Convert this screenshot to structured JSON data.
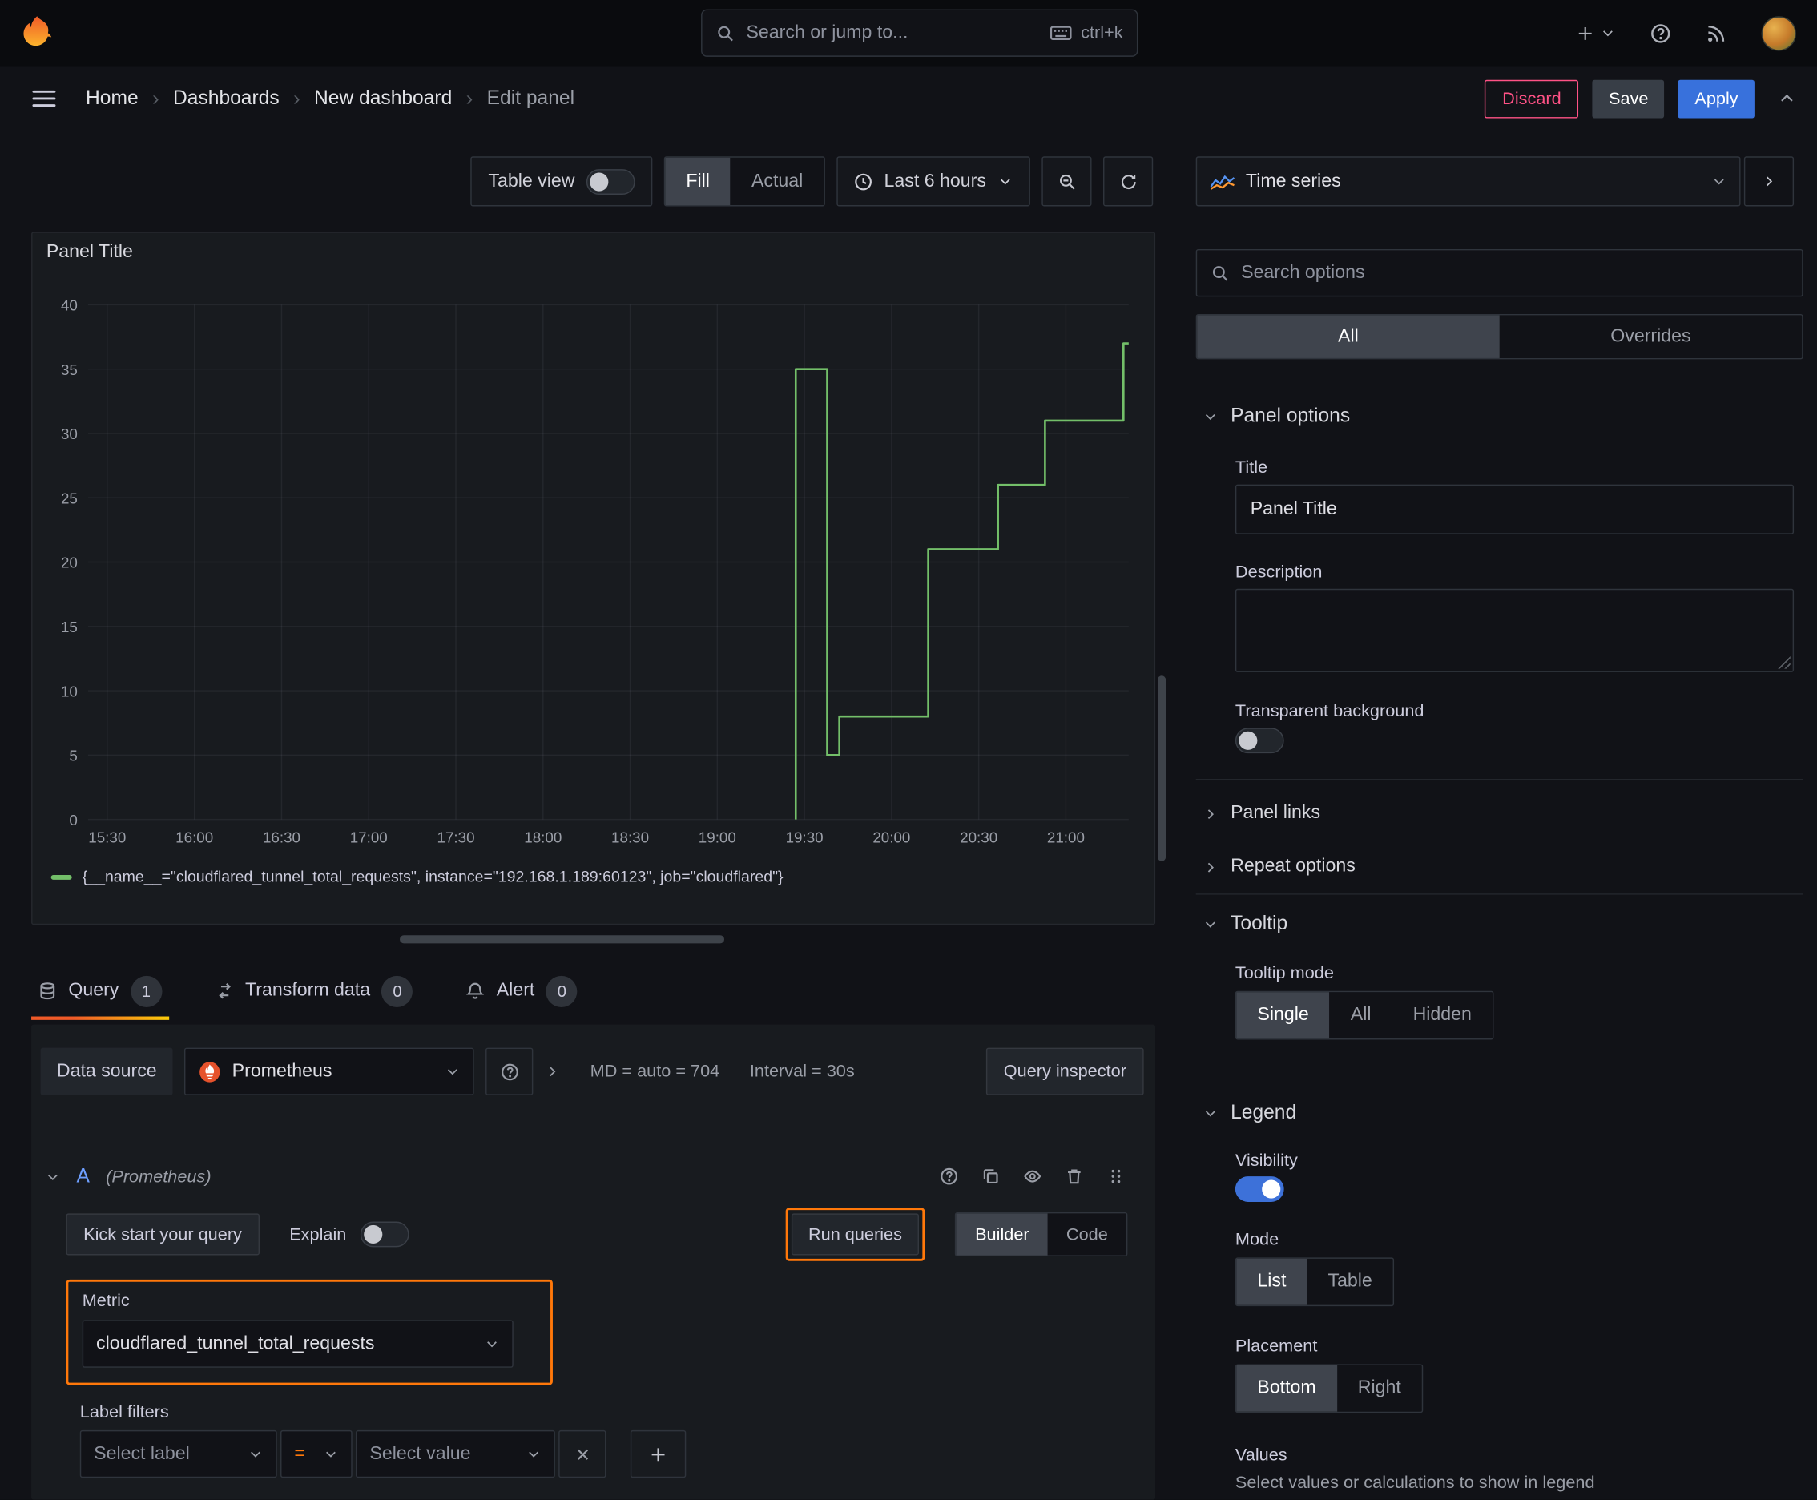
{
  "topbar": {
    "search_placeholder": "Search or jump to...",
    "shortcut": "ctrl+k"
  },
  "breadcrumb": {
    "items": [
      "Home",
      "Dashboards",
      "New dashboard",
      "Edit panel"
    ]
  },
  "actions": {
    "discard": "Discard",
    "save": "Save",
    "apply": "Apply"
  },
  "toolbar": {
    "table_view": "Table view",
    "fill": "Fill",
    "actual": "Actual",
    "time_range": "Last 6 hours"
  },
  "panel": {
    "title": "Panel Title"
  },
  "chart_data": {
    "type": "line",
    "title": "Panel Title",
    "x_unit": "time_of_day_hours",
    "xlim": [
      15.39,
      21.36
    ],
    "ylim": [
      0,
      40
    ],
    "y_ticks": [
      0,
      5,
      10,
      15,
      20,
      25,
      30,
      35,
      40
    ],
    "x_ticks": [
      {
        "v": 15.5,
        "label": "15:30"
      },
      {
        "v": 16.0,
        "label": "16:00"
      },
      {
        "v": 16.5,
        "label": "16:30"
      },
      {
        "v": 17.0,
        "label": "17:00"
      },
      {
        "v": 17.5,
        "label": "17:30"
      },
      {
        "v": 18.0,
        "label": "18:00"
      },
      {
        "v": 18.5,
        "label": "18:30"
      },
      {
        "v": 19.0,
        "label": "19:00"
      },
      {
        "v": 19.5,
        "label": "19:30"
      },
      {
        "v": 20.0,
        "label": "20:00"
      },
      {
        "v": 20.5,
        "label": "20:30"
      },
      {
        "v": 21.0,
        "label": "21:00"
      }
    ],
    "grid": true,
    "legend_position": "bottom",
    "series": [
      {
        "name": "{__name__=\"cloudflared_tunnel_total_requests\", instance=\"192.168.1.189:60123\", job=\"cloudflared\"}",
        "color": "#73bf69",
        "points": [
          [
            19.45,
            0
          ],
          [
            19.45,
            35
          ],
          [
            19.63,
            35
          ],
          [
            19.63,
            5
          ],
          [
            19.7,
            5
          ],
          [
            19.7,
            8
          ],
          [
            20.21,
            8
          ],
          [
            20.21,
            21
          ],
          [
            20.61,
            21
          ],
          [
            20.61,
            26
          ],
          [
            20.88,
            26
          ],
          [
            20.88,
            31
          ],
          [
            21.33,
            31
          ],
          [
            21.33,
            37
          ],
          [
            21.36,
            37
          ]
        ]
      }
    ]
  },
  "tabs": {
    "query": "Query",
    "query_count": "1",
    "transform": "Transform data",
    "transform_count": "0",
    "alert": "Alert",
    "alert_count": "0"
  },
  "editor": {
    "datasource_label": "Data source",
    "datasource": "Prometheus",
    "max_dp": "MD = auto = 704",
    "interval": "Interval = 30s",
    "inspector": "Query inspector",
    "ref_id": "A",
    "ref_hint": "(Prometheus)",
    "kickstart": "Kick start your query",
    "explain": "Explain",
    "run_queries": "Run queries",
    "builder": "Builder",
    "code": "Code",
    "metric_label": "Metric",
    "metric_value": "cloudflared_tunnel_total_requests",
    "label_filters": "Label filters",
    "select_label": "Select label",
    "operator": "=",
    "select_value": "Select value"
  },
  "sidebar": {
    "visualization": "Time series",
    "search_placeholder": "Search options",
    "tabs": {
      "all": "All",
      "overrides": "Overrides"
    },
    "panel_options": {
      "header": "Panel options",
      "title_label": "Title",
      "title_value": "Panel Title",
      "description_label": "Description",
      "transparent_label": "Transparent background"
    },
    "links": {
      "panel_links": "Panel links",
      "repeat_options": "Repeat options"
    },
    "tooltip": {
      "header": "Tooltip",
      "mode_label": "Tooltip mode",
      "options": [
        "Single",
        "All",
        "Hidden"
      ]
    },
    "legend": {
      "header": "Legend",
      "visibility_label": "Visibility",
      "mode_label": "Mode",
      "modes": [
        "List",
        "Table"
      ],
      "placement_label": "Placement",
      "placements": [
        "Bottom",
        "Right"
      ],
      "values_label": "Values",
      "values_hint": "Select values or calculations to show in legend"
    }
  },
  "colors": {
    "accent_orange": "#ff780a",
    "series_green": "#73bf69",
    "apply_blue": "#3871dc",
    "discard_red": "#ff5286"
  }
}
